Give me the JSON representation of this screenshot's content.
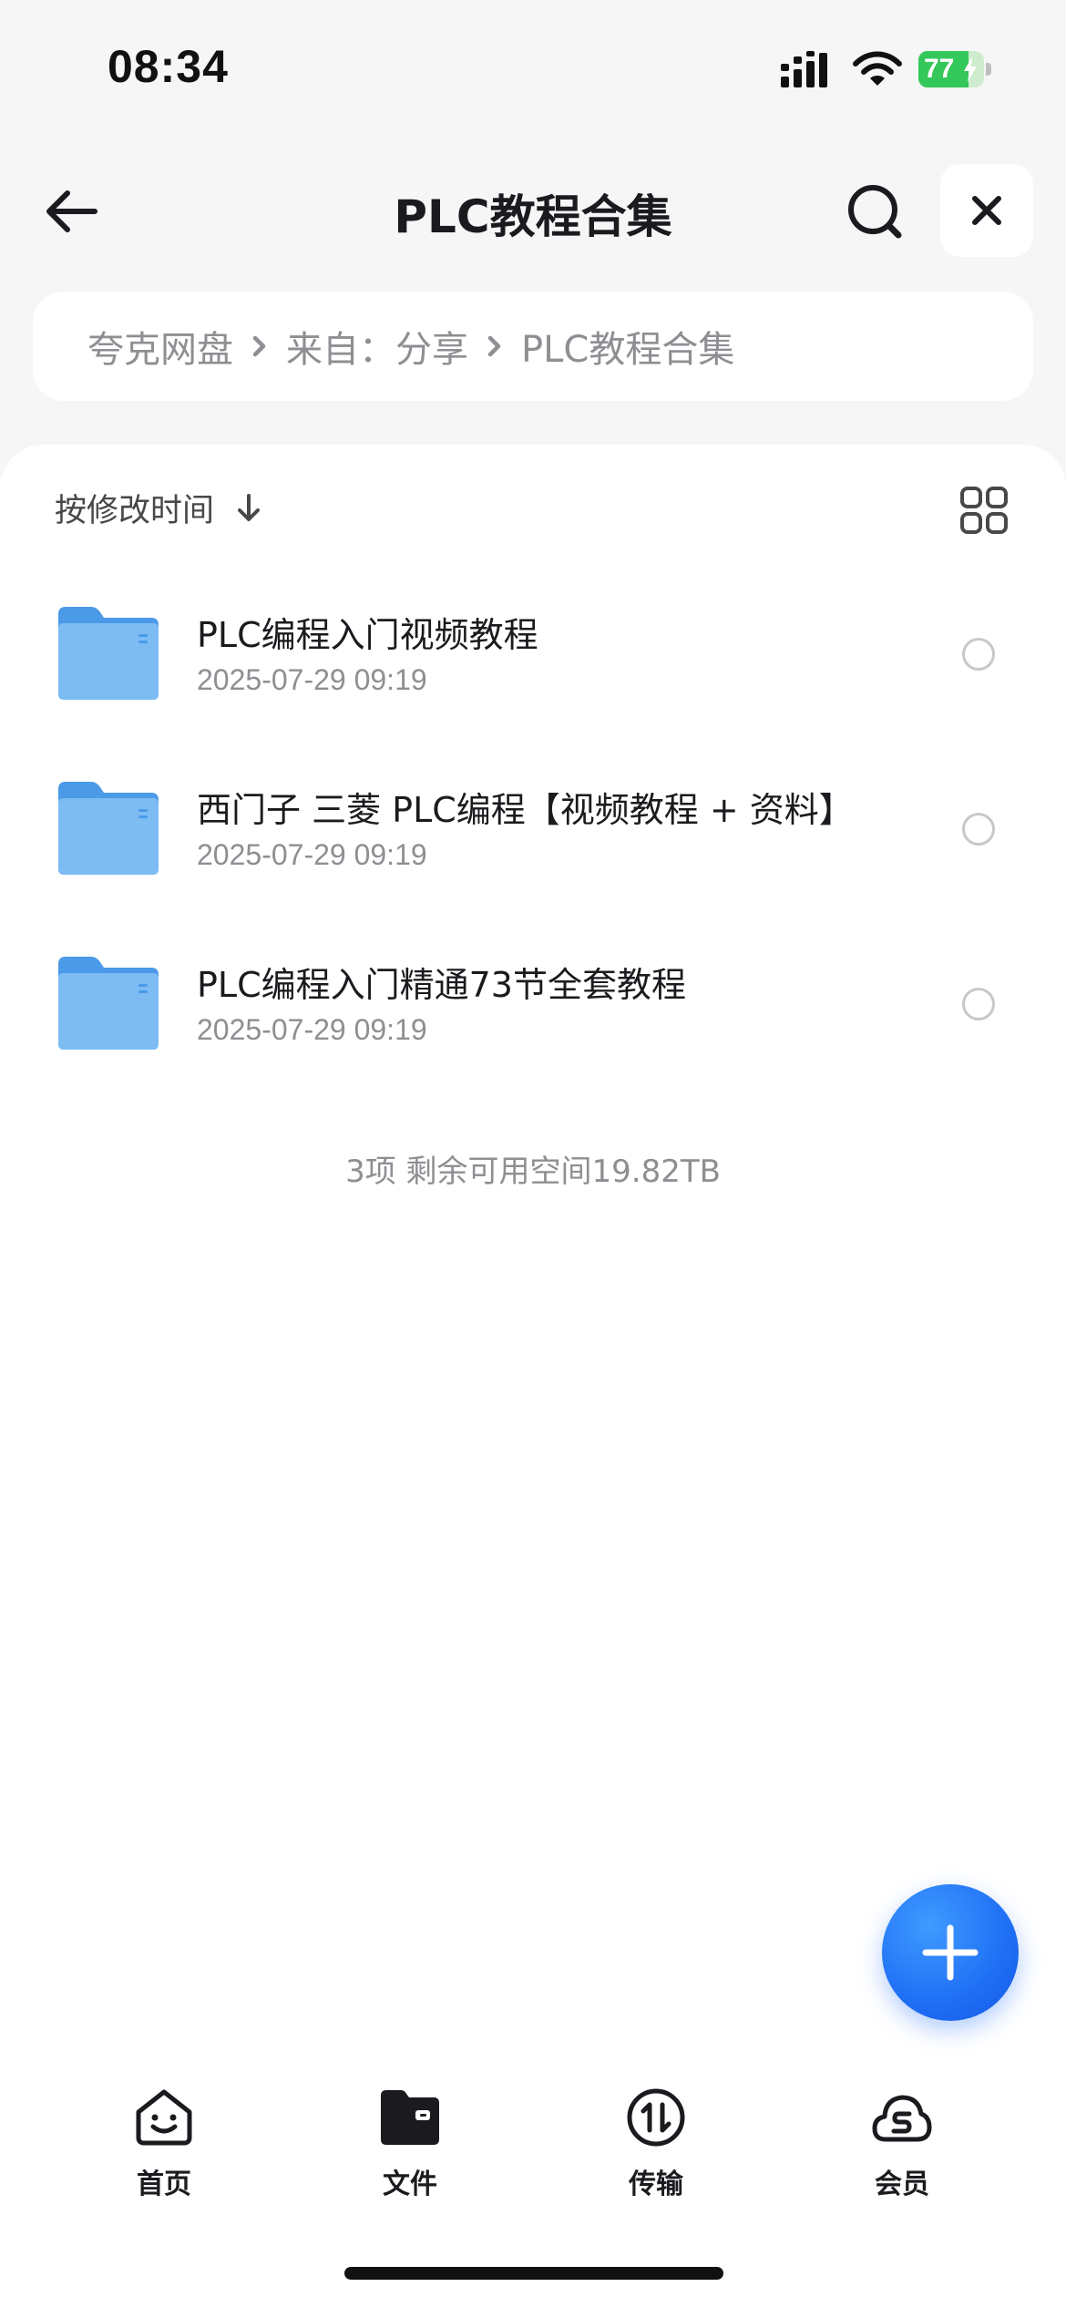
{
  "status_bar": {
    "time": "08:34",
    "battery_level": "77",
    "battery_fraction": 0.77,
    "icons": [
      "cellular-signal-icon",
      "wifi-icon",
      "battery-charging-icon"
    ]
  },
  "nav": {
    "title": "PLC教程合集",
    "icons": [
      "back-arrow-icon",
      "search-icon",
      "close-icon"
    ]
  },
  "breadcrumb": {
    "items": [
      "夸克网盘",
      "来自：分享",
      "PLC教程合集"
    ]
  },
  "toolbar": {
    "sort_label": "按修改时间",
    "icons": [
      "arrow-down-icon",
      "grid-view-icon"
    ]
  },
  "files": [
    {
      "name": "PLC编程入门视频教程",
      "date": "2025-07-29 09:19"
    },
    {
      "name": "西门子 三菱 PLC编程【视频教程 + 资料】",
      "date": "2025-07-29 09:19"
    },
    {
      "name": "PLC编程入门精通73节全套教程",
      "date": "2025-07-29 09:19"
    }
  ],
  "summary": "3项 剩余可用空间19.82TB",
  "fab": {
    "icon": "plus-icon"
  },
  "tabs": [
    {
      "label": "首页",
      "icon": "smiley-home-icon"
    },
    {
      "label": "文件",
      "icon": "folder-filled-icon"
    },
    {
      "label": "传输",
      "icon": "transfer-arrows-icon"
    },
    {
      "label": "会员",
      "icon": "cloud-membership-icon"
    }
  ],
  "colors": {
    "accent": "#1f6ff5",
    "folder": "#5aa9f0",
    "battery": "#34c759",
    "muted_text": "#8e8e93"
  }
}
